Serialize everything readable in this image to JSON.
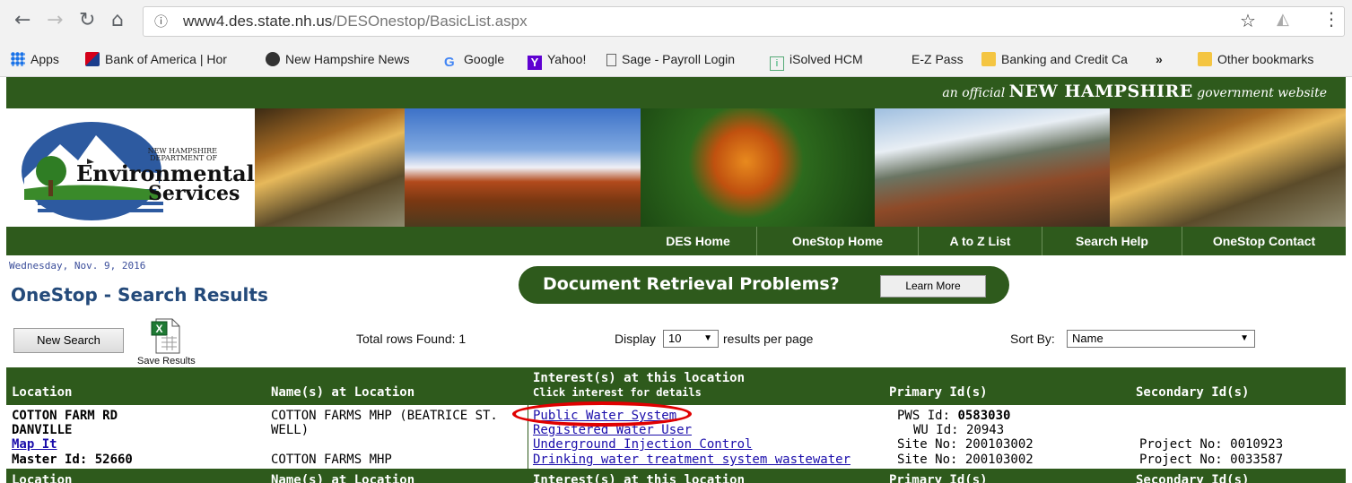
{
  "browser": {
    "url_host": "www4.des.state.nh.us",
    "url_path": "/DESOnestop/BasicList.aspx",
    "bookmarks": [
      "Apps",
      "Bank of America | Hor",
      "New Hampshire News",
      "Google",
      "Yahoo!",
      "Sage - Payroll Login",
      "iSolved HCM",
      "E-Z Pass",
      "Banking and Credit Ca",
      "»",
      "Other bookmarks"
    ]
  },
  "header": {
    "official_prefix": "an official",
    "official_state": "NEW HAMPSHIRE",
    "official_suffix": "government website",
    "logo_line1": "NEW HAMPSHIRE",
    "logo_line2": "DEPARTMENT OF",
    "logo_line3": "Environmental",
    "logo_line4": "Services"
  },
  "menu": [
    "DES Home",
    "OneStop Home",
    "A to Z List",
    "Search Help",
    "OneStop Contact"
  ],
  "page": {
    "date": "Wednesday, Nov. 9, 2016",
    "title": "OneStop - Search Results",
    "doc_banner": "Document Retrieval Problems?",
    "learn_more": "Learn More",
    "new_search": "New Search",
    "save_results": "Save Results",
    "total_rows": "Total rows Found: 1",
    "display_label": "Display",
    "display_value": "10",
    "results_per_page": "results per page",
    "sort_label": "Sort By:",
    "sort_value": "Name"
  },
  "table": {
    "headers": {
      "location": "Location",
      "names": "Name(s) at Location",
      "interests": "Interest(s) at this location",
      "interests_sub": "Click interest for details",
      "primary": "Primary Id(s)",
      "secondary": "Secondary Id(s)"
    },
    "row": {
      "street": "COTTON FARM RD",
      "town": "DANVILLE",
      "map_it": "Map It",
      "master_id": "Master Id: 52660",
      "name1": "COTTON FARMS MHP (BEATRICE ST.",
      "name1b": "WELL)",
      "name2": "COTTON FARMS MHP",
      "interests": [
        "Public Water System",
        "Registered Water User",
        "Underground Injection Control",
        "Drinking water treatment system wastewater"
      ],
      "pws_label": "PWS Id:",
      "pws_value": "0583030",
      "wu": "WU Id: 20943",
      "site1": "Site No: 200103002",
      "site2": "Site No: 200103002",
      "project1": "Project No: 0010923",
      "project2": "Project No: 0033587"
    }
  },
  "colors": {
    "nh_green": "#2e5a1c",
    "link": "#1a0dab",
    "highlight_circle": "#e00000"
  }
}
